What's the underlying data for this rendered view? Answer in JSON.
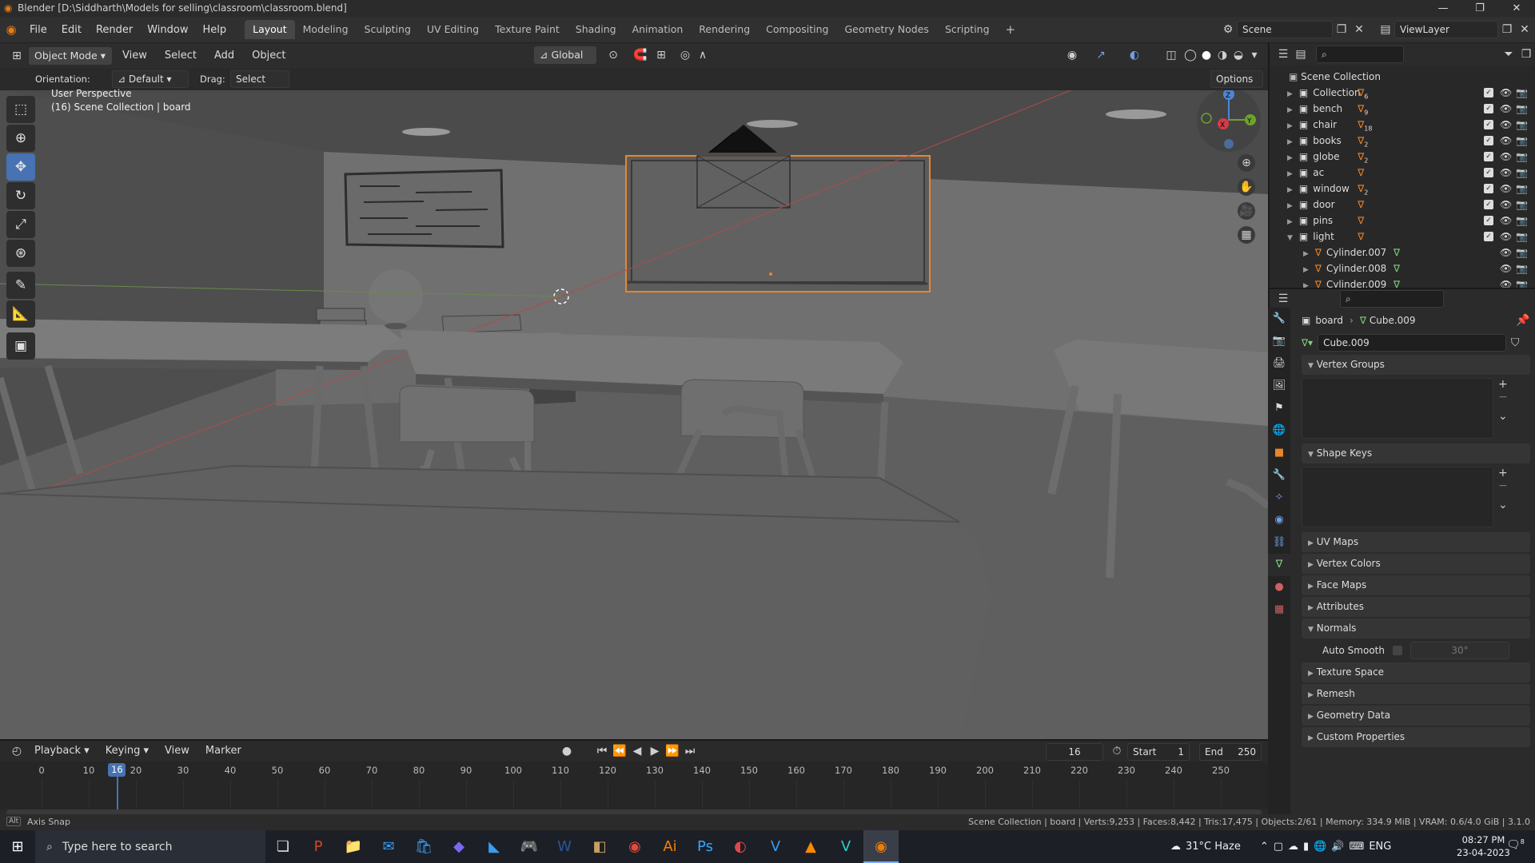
{
  "window": {
    "title": "Blender [D:\\Siddharth\\Models for selling\\classroom\\classroom.blend]",
    "controls": [
      "—",
      "❐",
      "✕"
    ]
  },
  "menubar": {
    "menus": [
      "File",
      "Edit",
      "Render",
      "Window",
      "Help"
    ],
    "workspaces": [
      "Layout",
      "Modeling",
      "Sculpting",
      "UV Editing",
      "Texture Paint",
      "Shading",
      "Animation",
      "Rendering",
      "Compositing",
      "Geometry Nodes",
      "Scripting"
    ],
    "active_workspace": "Layout",
    "add_workspace": "+",
    "scene": "Scene",
    "view_layer": "ViewLayer"
  },
  "viewport_header": {
    "mode": "Object Mode",
    "menus": [
      "View",
      "Select",
      "Add",
      "Object"
    ],
    "transform_orientation": "Global",
    "orientation_label": "Orientation:",
    "orientation_value": "Default",
    "drag_label": "Drag:",
    "drag_value": "Select Box",
    "options": "Options"
  },
  "viewport": {
    "perspective": "User Perspective",
    "collection_info": "(16) Scene Collection | board",
    "gizmo_axes": [
      "Z",
      "X",
      "Y"
    ]
  },
  "tools": [
    "select-box",
    "cursor",
    "move",
    "rotate",
    "scale",
    "transform",
    "annotate",
    "measure",
    "add-cube"
  ],
  "outliner": {
    "root": "Scene Collection",
    "items": [
      {
        "name": "Collection",
        "badge": "6",
        "expanded": false
      },
      {
        "name": "bench",
        "badge": "9",
        "expanded": false
      },
      {
        "name": "chair",
        "badge": "18",
        "expanded": false
      },
      {
        "name": "books",
        "badge": "2",
        "expanded": false
      },
      {
        "name": "globe",
        "badge": "2",
        "expanded": false
      },
      {
        "name": "ac",
        "badge": "",
        "expanded": false
      },
      {
        "name": "window",
        "badge": "2",
        "expanded": false
      },
      {
        "name": "door",
        "badge": "",
        "expanded": false
      },
      {
        "name": "pins",
        "badge": "",
        "expanded": false
      },
      {
        "name": "light",
        "badge": "",
        "expanded": true
      }
    ],
    "children": [
      "Cylinder.007",
      "Cylinder.008",
      "Cylinder.009"
    ]
  },
  "properties": {
    "breadcrumb_object": "board",
    "breadcrumb_data": "Cube.009",
    "mesh_name": "Cube.009",
    "panels": [
      {
        "label": "Vertex Groups",
        "open": true
      },
      {
        "label": "Shape Keys",
        "open": true
      },
      {
        "label": "UV Maps",
        "open": false
      },
      {
        "label": "Vertex Colors",
        "open": false
      },
      {
        "label": "Face Maps",
        "open": false
      },
      {
        "label": "Attributes",
        "open": false
      },
      {
        "label": "Normals",
        "open": true
      },
      {
        "label": "Texture Space",
        "open": false
      },
      {
        "label": "Remesh",
        "open": false
      },
      {
        "label": "Geometry Data",
        "open": false
      },
      {
        "label": "Custom Properties",
        "open": false
      }
    ],
    "auto_smooth_label": "Auto Smooth",
    "auto_smooth_angle": "30°"
  },
  "timeline": {
    "menus": [
      "Playback",
      "Keying",
      "View",
      "Marker"
    ],
    "current_frame": "16",
    "start_label": "Start",
    "start": "1",
    "end_label": "End",
    "end": "250",
    "ruler": [
      "0",
      "10",
      "20",
      "30",
      "40",
      "50",
      "60",
      "70",
      "80",
      "90",
      "100",
      "110",
      "120",
      "130",
      "140",
      "150",
      "160",
      "170",
      "180",
      "190",
      "200",
      "210",
      "220",
      "230",
      "240",
      "250"
    ],
    "playhead_frame": 16
  },
  "statusbar": {
    "left": "Axis Snap",
    "right": "Scene Collection | board | Verts:9,253 | Faces:8,442 | Tris:17,475 | Objects:2/61 | Memory: 334.9 MiB | VRAM: 0.6/4.0 GiB | 3.1.0"
  },
  "taskbar": {
    "search_placeholder": "Type here to search",
    "weather": "31°C Haze",
    "language": "ENG",
    "time": "08:27 PM",
    "date": "23-04-2023",
    "notifications": "8"
  }
}
